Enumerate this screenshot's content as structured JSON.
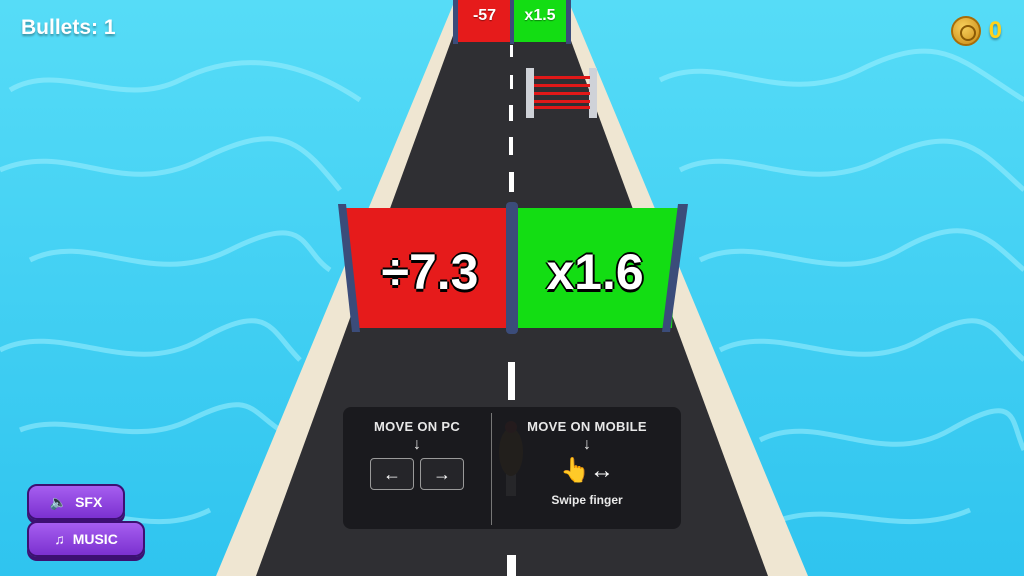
{
  "hud": {
    "bullets_label": "Bullets: 1",
    "coins": "0",
    "coin_icon": "coin-icon"
  },
  "gates_near": {
    "left_label": "÷7.3",
    "right_label": "x1.6",
    "left_color": "#e61b1b",
    "right_color": "#13dd13"
  },
  "gates_far": {
    "left_label": "-57",
    "right_label": "x1.5",
    "left_color": "#e61b1b",
    "right_color": "#13dd13"
  },
  "tutorial": {
    "pc_title": "MOVE ON PC",
    "pc_arrow": "↓",
    "key_left": "←",
    "key_right": "→",
    "mobile_title": "MOVE ON MOBILE",
    "mobile_arrow": "↓",
    "swipe_glyph": "👆↔",
    "swipe_label": "Swipe finger"
  },
  "buttons": {
    "sfx_label": "SFX",
    "sfx_icon": "speaker-icon",
    "music_label": "MUSIC",
    "music_icon": "music-note-icon"
  },
  "colors": {
    "water": "#3fd3f5",
    "road": "#2f2f33",
    "road_edge": "#efe6d2",
    "button": "#8a3fe0"
  }
}
